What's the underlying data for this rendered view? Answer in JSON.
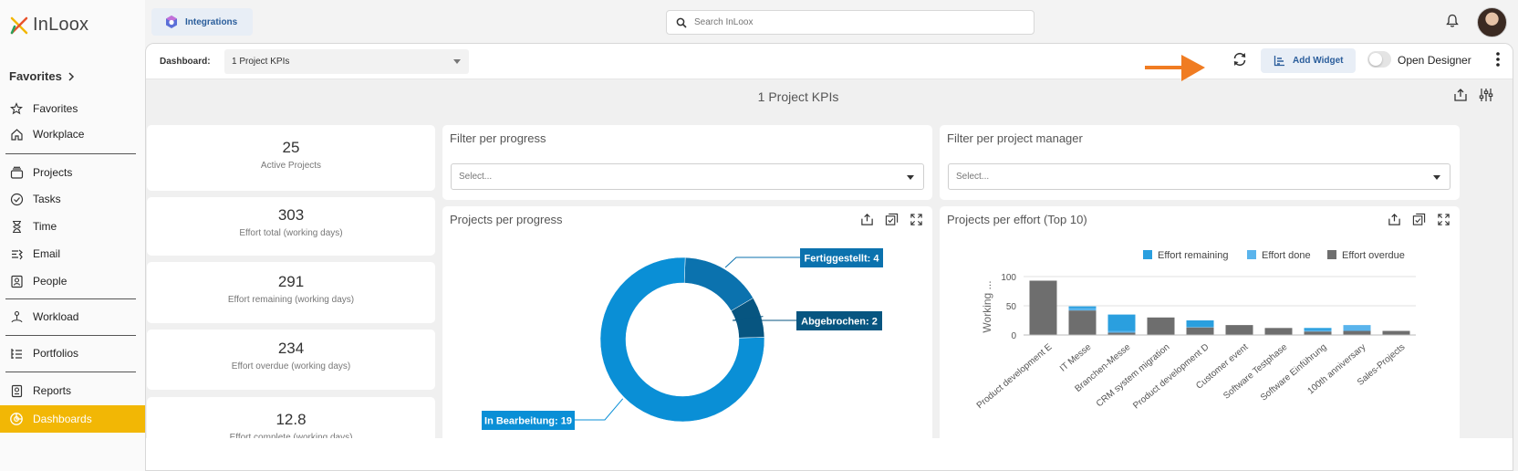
{
  "app": {
    "logo_text": "InLoox"
  },
  "sidebar": {
    "favorites_header": "Favorites",
    "items": [
      {
        "label": "Favorites",
        "icon": "star-icon"
      },
      {
        "label": "Workplace",
        "icon": "home-icon"
      },
      {
        "label": "Projects",
        "icon": "projects-icon"
      },
      {
        "label": "Tasks",
        "icon": "check-circle-icon"
      },
      {
        "label": "Time",
        "icon": "hourglass-icon"
      },
      {
        "label": "Email",
        "icon": "email-icon"
      },
      {
        "label": "People",
        "icon": "contact-card-icon"
      },
      {
        "label": "Workload",
        "icon": "workload-icon"
      },
      {
        "label": "Portfolios",
        "icon": "portfolio-icon"
      },
      {
        "label": "Reports",
        "icon": "reports-icon"
      },
      {
        "label": "Dashboards",
        "icon": "dashboard-icon",
        "active": true
      }
    ]
  },
  "topbar": {
    "integrations_label": "Integrations",
    "search_placeholder": "Search InLoox"
  },
  "dashboard_bar": {
    "label": "Dashboard:",
    "selected": "1 Project KPIs",
    "add_widget_label": "Add Widget",
    "open_designer_label": "Open Designer",
    "open_designer_enabled": false
  },
  "dashboard": {
    "title": "1 Project KPIs",
    "kpis": [
      {
        "value": "25",
        "label": "Active Projects"
      },
      {
        "value": "303",
        "label": "Effort total (working days)"
      },
      {
        "value": "291",
        "label": "Effort remaining (working days)"
      },
      {
        "value": "234",
        "label": "Effort overdue (working days)"
      },
      {
        "value": "12.8",
        "label": "Effort complete (working days)"
      }
    ],
    "filter_progress": {
      "title": "Filter per progress",
      "placeholder": "Select..."
    },
    "filter_manager": {
      "title": "Filter per project manager",
      "placeholder": "Select..."
    },
    "progress_chart_title": "Projects per progress",
    "effort_chart_title": "Projects per effort (Top 10)"
  },
  "colors": {
    "accent_yellow": "#f2b705",
    "brand_blue": "#2a5d9b",
    "arrow_orange": "#f07c22",
    "donut_blue": "#0a8fd6",
    "donut_mid": "#0b72ae",
    "donut_dark": "#075580",
    "effort_remaining": "#2a9fdf",
    "effort_done": "#5ab4ec",
    "effort_overdue": "#6e6e6e"
  },
  "chart_data": [
    {
      "type": "pie",
      "variant": "donut",
      "labels": [
        "In Bearbeitung",
        "Fertiggestellt",
        "Abgebrochen"
      ],
      "values": [
        19,
        4,
        2
      ],
      "data_labels": [
        "In Bearbeitung: 19",
        "Fertiggestellt: 4",
        "Abgebrochen: 2"
      ]
    },
    {
      "type": "bar",
      "stacked": true,
      "categories": [
        "Product development E",
        "IT Messe",
        "Branchen-Messe",
        "CRM system migration",
        "Product development D",
        "Customer event",
        "Software Testphase",
        "Software Einführung",
        "100th anniversary",
        "Sales-Projects"
      ],
      "series": [
        {
          "name": "Effort remaining",
          "values": [
            0,
            3,
            28,
            0,
            11,
            0,
            0,
            4,
            0,
            0
          ]
        },
        {
          "name": "Effort done",
          "values": [
            0,
            4,
            3,
            0,
            1,
            0,
            0,
            2,
            10,
            0
          ]
        },
        {
          "name": "Effort overdue",
          "values": [
            93,
            42,
            4,
            30,
            13,
            17,
            12,
            6,
            7,
            7
          ]
        }
      ],
      "ylabel": "Working ...",
      "yticks": [
        0,
        50,
        100
      ],
      "ylim": [
        0,
        100
      ],
      "legend": "top-right",
      "grid": true
    }
  ]
}
